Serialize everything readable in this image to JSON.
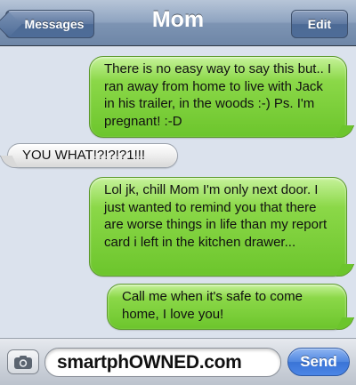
{
  "nav": {
    "back_label": "Messages",
    "title": "Mom",
    "edit_label": "Edit"
  },
  "messages": [
    {
      "from": "me",
      "text": "There is no easy way to say this but.. I ran away from home to live with Jack in his trailer, in the woods :-) Ps. I'm pregnant! :-D"
    },
    {
      "from": "mom",
      "text": "YOU WHAT!?!?!?1!!!"
    },
    {
      "from": "me",
      "text": "Lol jk, chill Mom I'm only next door. I just wanted to remind you that there are worse things in life than my report card i left in the kitchen drawer..."
    },
    {
      "from": "me",
      "text": "Call me when it's safe to come home, I love you!"
    }
  ],
  "input": {
    "value": "smartphOWNED.com",
    "send_label": "Send",
    "camera_icon": "camera-icon"
  },
  "colors": {
    "sent_bubble": "#6cc52c",
    "received_bubble": "#f0f0f0",
    "background": "#dbe2ed",
    "send_button": "#3a74d6"
  }
}
